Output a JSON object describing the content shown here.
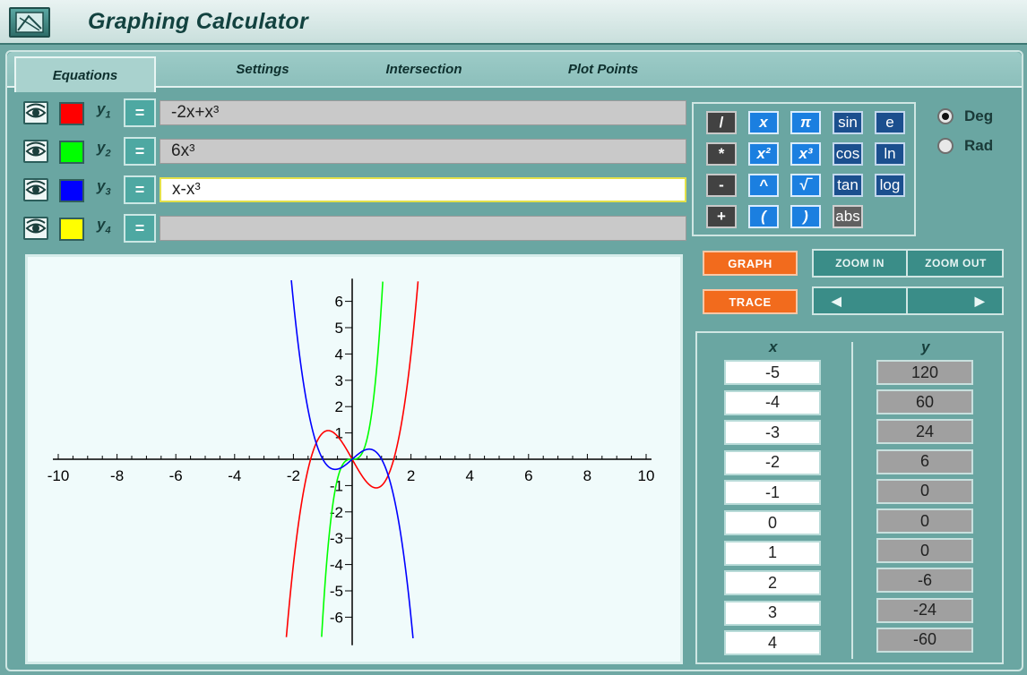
{
  "app": {
    "title": "Graphing Calculator",
    "icon": "calculator-graph-icon"
  },
  "tabs": [
    {
      "label": "Equations",
      "active": true
    },
    {
      "label": "Settings",
      "active": false
    },
    {
      "label": "Intersection",
      "active": false
    },
    {
      "label": "Plot Points",
      "active": false
    }
  ],
  "equations": [
    {
      "label": "y",
      "index": "1",
      "color": "#ff0000",
      "expr": "-2x+x³",
      "visible": true,
      "active": false
    },
    {
      "label": "y",
      "index": "2",
      "color": "#00ff00",
      "expr": "6x³",
      "visible": true,
      "active": false
    },
    {
      "label": "y",
      "index": "3",
      "color": "#0000ff",
      "expr": "x-x³",
      "visible": true,
      "active": true
    },
    {
      "label": "y",
      "index": "4",
      "color": "#ffff00",
      "expr": "",
      "visible": true,
      "active": false
    }
  ],
  "eq_button": "=",
  "keypad": [
    [
      "/",
      "x",
      "π",
      "sin",
      "e"
    ],
    [
      "*",
      "x²",
      "x³",
      "cos",
      "ln"
    ],
    [
      "-",
      "^",
      "√‾",
      "tan",
      "log"
    ],
    [
      "+",
      "(",
      ")",
      "abs",
      ""
    ]
  ],
  "angle_mode": {
    "options": [
      "Deg",
      "Rad"
    ],
    "selected": "Deg"
  },
  "buttons": {
    "graph": "GRAPH",
    "trace": "TRACE",
    "zoom_in": "ZOOM IN",
    "zoom_out": "ZOOM OUT",
    "trace_left": "◀",
    "trace_right": "▶"
  },
  "table": {
    "x_header": "x",
    "y_header": "y",
    "x": [
      "-5",
      "-4",
      "-3",
      "-2",
      "-1",
      "0",
      "1",
      "2",
      "3",
      "4"
    ],
    "y": [
      "120",
      "60",
      "24",
      "6",
      "0",
      "0",
      "0",
      "-6",
      "-24",
      "-60"
    ]
  },
  "chart_data": {
    "type": "line",
    "xlim": [
      -10,
      10
    ],
    "ylim": [
      -7,
      7
    ],
    "x_ticks": [
      -10,
      -8,
      -6,
      -4,
      -2,
      0,
      2,
      4,
      6,
      8,
      10
    ],
    "y_ticks": [
      -6,
      -5,
      -4,
      -3,
      -2,
      -1,
      1,
      2,
      3,
      4,
      5,
      6
    ],
    "series": [
      {
        "expr": "-2x+x³",
        "color": "#ff0000"
      },
      {
        "expr": "6x³",
        "color": "#00ff00"
      },
      {
        "expr": "x-x³",
        "color": "#0000ff"
      }
    ]
  }
}
